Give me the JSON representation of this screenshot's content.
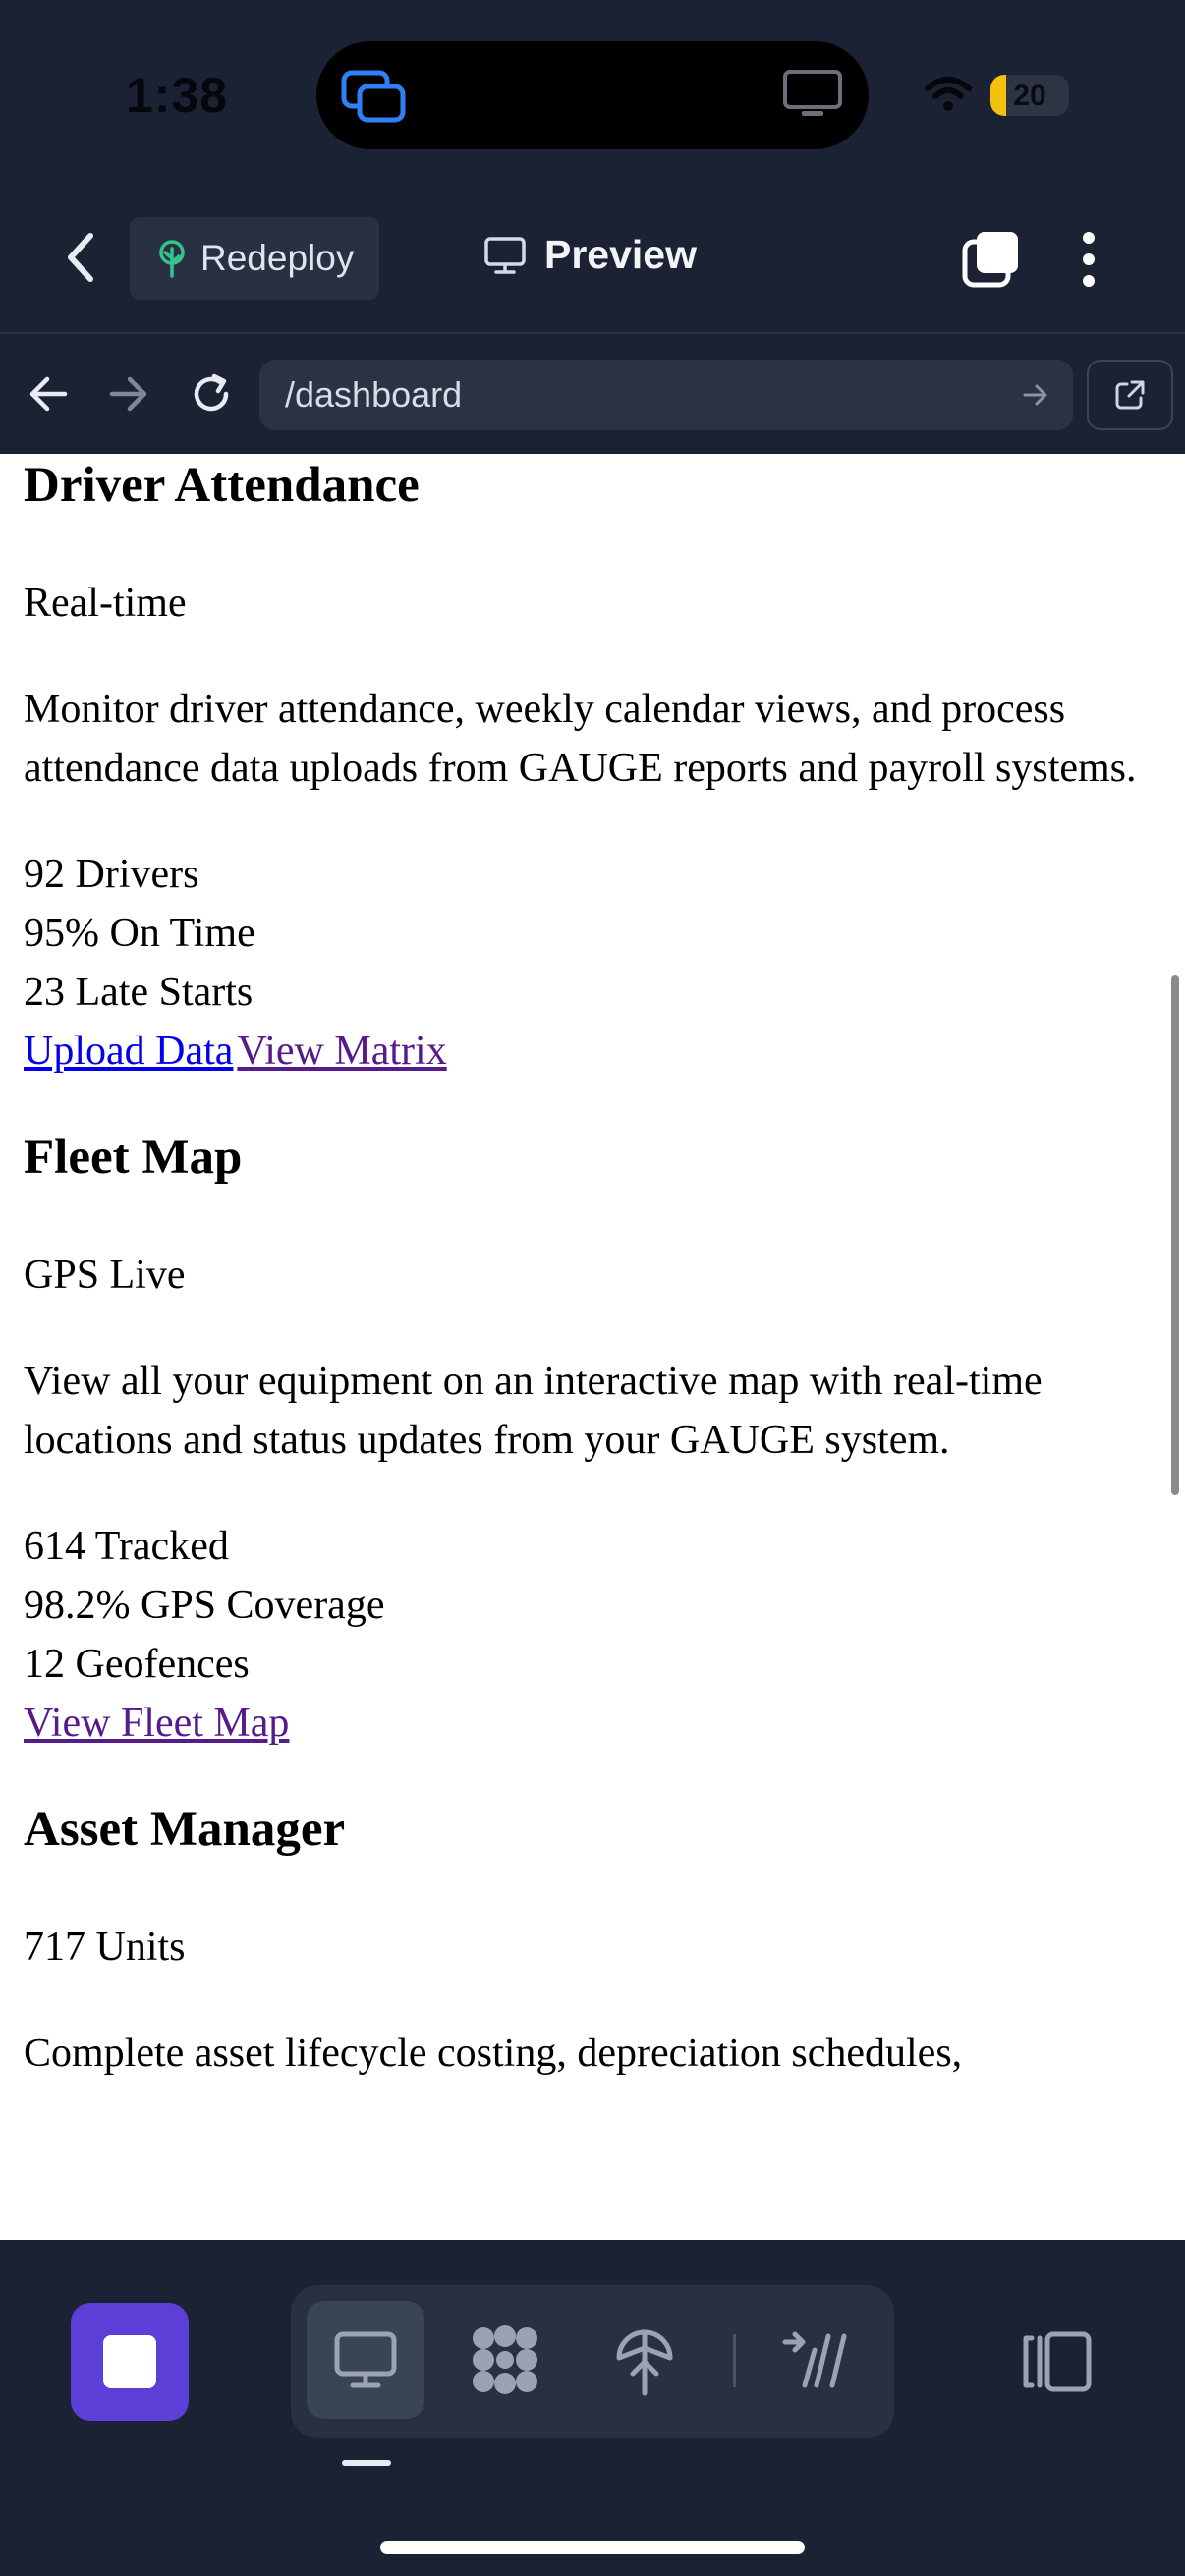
{
  "status_bar": {
    "time": "1:38",
    "battery": "20",
    "battery_level": 0.2
  },
  "header": {
    "redeploy_label": "Redeploy",
    "preview_label": "Preview"
  },
  "browser": {
    "url": "/dashboard"
  },
  "content": {
    "driver": {
      "heading": "Driver Attendance",
      "badge": "Real-time",
      "description": "Monitor driver attendance, weekly calendar views, and process attendance data uploads from GAUGE reports and payroll systems.",
      "stats": [
        "92 Drivers",
        "95% On Time",
        "23 Late Starts"
      ],
      "link_upload": "Upload Data",
      "link_matrix": "View Matrix"
    },
    "fleet": {
      "heading": "Fleet Map",
      "badge": "GPS Live",
      "description": "View all your equipment on an interactive map with real-time locations and status updates from your GAUGE system.",
      "stats": [
        "614 Tracked",
        "98.2% GPS Coverage",
        "12 Geofences"
      ],
      "link_map": "View Fleet Map"
    },
    "asset": {
      "heading": "Asset Manager",
      "badge": "717 Units",
      "description": "Complete asset lifecycle costing, depreciation schedules,"
    }
  },
  "toolbar": {
    "icons": [
      "stop-icon",
      "monitor-icon",
      "apps-icon",
      "deploy-icon",
      "tools-icon",
      "panel-icon"
    ],
    "accent": "#5b3fd6"
  }
}
